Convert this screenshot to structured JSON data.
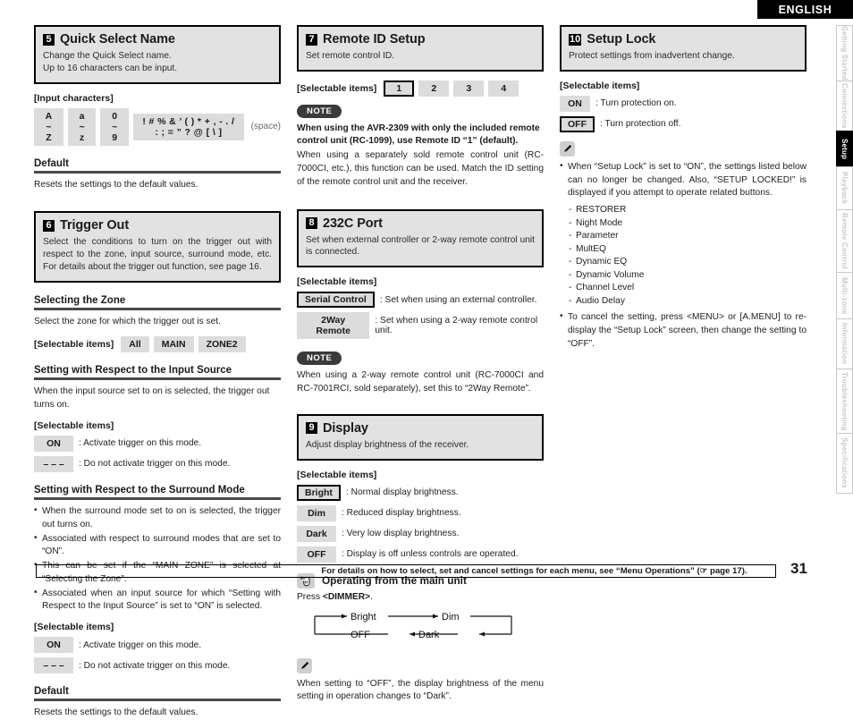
{
  "header": {
    "language": "ENGLISH"
  },
  "footer": {
    "note": "For details on how to select, set and cancel settings for each menu, see “Menu Operations” (☞ page 17).",
    "page_number": "31"
  },
  "tabs": [
    {
      "label": "Getting Started",
      "active": false
    },
    {
      "label": "Connections",
      "active": false
    },
    {
      "label": "Setup",
      "active": true
    },
    {
      "label": "Playback",
      "active": false
    },
    {
      "label": "Remote Control",
      "active": false
    },
    {
      "label": "Multi-zone",
      "active": false
    },
    {
      "label": "Information",
      "active": false
    },
    {
      "label": "Troubleshooting",
      "active": false
    },
    {
      "label": "Specifications",
      "active": false
    }
  ],
  "sections": {
    "quick_select": {
      "number": "5",
      "title": "Quick Select Name",
      "desc_line1": "Change the Quick Select name.",
      "desc_line2": "Up to 16 characters can be input.",
      "input_chars_label": "[Input characters]",
      "chips": [
        "A ~ Z",
        "a ~ z",
        "0 ~ 9"
      ],
      "symbols": "! # % & ’ ( ) * + , - . / : ; = ” ? @ [ \\ ]",
      "space_note": "(space)",
      "default_head": "Default",
      "default_text": "Resets the settings to the default values."
    },
    "trigger_out": {
      "number": "6",
      "title": "Trigger Out",
      "desc": "Select the conditions to turn on the trigger out with respect to the zone, input source, surround mode, etc. For details about the trigger out function, see page 16.",
      "zone_head": "Selecting the Zone",
      "zone_text": "Select the zone for which the trigger out is set.",
      "selectable_label": "[Selectable items]",
      "zone_items": [
        "All",
        "MAIN",
        "ZONE2"
      ],
      "input_head": "Setting with Respect to the Input Source",
      "input_text": "When the input source set to on is selected, the trigger out turns on.",
      "input_items": [
        {
          "chip": "ON",
          "desc": ": Activate trigger on this mode."
        },
        {
          "chip": "– – –",
          "desc": ": Do not activate trigger on this mode."
        }
      ],
      "surround_head": "Setting with Respect to the Surround Mode",
      "surround_bullets": [
        "When the surround mode set to on is selected, the trigger out turns on.",
        "Associated with respect to surround modes that are set to “ON”.",
        "This can be set if the “MAIN ZONE” is selected at “Selecting the Zone”.",
        "Associated when an input source for which “Setting with Respect to the Input Source” is set to “ON” is selected."
      ],
      "surround_items": [
        {
          "chip": "ON",
          "desc": ": Activate trigger on this mode."
        },
        {
          "chip": "– – –",
          "desc": ": Do not activate trigger on this mode."
        }
      ],
      "default_head": "Default",
      "default_text": "Resets the settings to the default values."
    },
    "remote_id": {
      "number": "7",
      "title": "Remote ID Setup",
      "desc": "Set remote control ID.",
      "selectable_label": "[Selectable items]",
      "items": [
        {
          "label": "1",
          "selected": true
        },
        {
          "label": "2",
          "selected": false
        },
        {
          "label": "3",
          "selected": false
        },
        {
          "label": "4",
          "selected": false
        }
      ],
      "note_label": "NOTE",
      "note_bold": "When using the AVR-2309 with only the included remote control unit (RC-1099), use Remote ID “1” (default).",
      "note_body": "When using a separately sold remote control unit (RC-7000CI, etc.), this function can be used. Match the ID setting of the remote control unit and the receiver."
    },
    "port_232c": {
      "number": "8",
      "title": "232C Port",
      "desc": "Set when external controller or 2-way remote control unit is connected.",
      "selectable_label": "[Selectable items]",
      "items": [
        {
          "chip": "Serial Control",
          "desc": ": Set when using an external controller.",
          "selected": true
        },
        {
          "chip": "2Way Remote",
          "desc": ": Set when using a 2-way remote control unit.",
          "selected": false
        }
      ],
      "note_label": "NOTE",
      "note_body": "When using a 2-way remote control unit (RC-7000CI and RC-7001RCI, sold separately), set this to “2Way Remote”."
    },
    "display": {
      "number": "9",
      "title": "Display",
      "desc": "Adjust display brightness of the receiver.",
      "selectable_label": "[Selectable items]",
      "items": [
        {
          "chip": "Bright",
          "desc": ": Normal display brightness.",
          "selected": true
        },
        {
          "chip": "Dim",
          "desc": ": Reduced display brightness.",
          "selected": false
        },
        {
          "chip": "Dark",
          "desc": ": Very low display brightness.",
          "selected": false
        },
        {
          "chip": "OFF",
          "desc": ": Display is off unless controls are operated.",
          "selected": false
        }
      ],
      "op_title": "Operating from the main unit",
      "op_press_prefix": "Press ",
      "op_press_button": "<DIMMER>",
      "op_press_suffix": ".",
      "cycle": [
        "Bright",
        "Dim",
        "Dark",
        "OFF"
      ],
      "memo_body": "When setting to “OFF”, the display brightness of the menu setting in operation changes to “Dark”."
    },
    "setup_lock": {
      "number": "10",
      "title": "Setup Lock",
      "desc": "Protect settings from inadvertent change.",
      "selectable_label": "[Selectable items]",
      "items": [
        {
          "chip": "ON",
          "desc": ": Turn protection on.",
          "selected": false
        },
        {
          "chip": "OFF",
          "desc": ": Turn protection off.",
          "selected": true
        }
      ],
      "memo_bullet1": "When “Setup Lock” is set to “ON”, the settings listed below can no longer be changed. Also, “SETUP LOCKED!” is displayed if you attempt to operate related buttons.",
      "locked_list": [
        "RESTORER",
        "Night Mode",
        "Parameter",
        "MultEQ",
        "Dynamic EQ",
        "Dynamic Volume",
        "Channel Level",
        "Audio Delay"
      ],
      "memo_bullet2": "To cancel the setting, press <MENU> or [A.MENU] to re-display the “Setup Lock” screen, then change the setting to “OFF”."
    }
  }
}
